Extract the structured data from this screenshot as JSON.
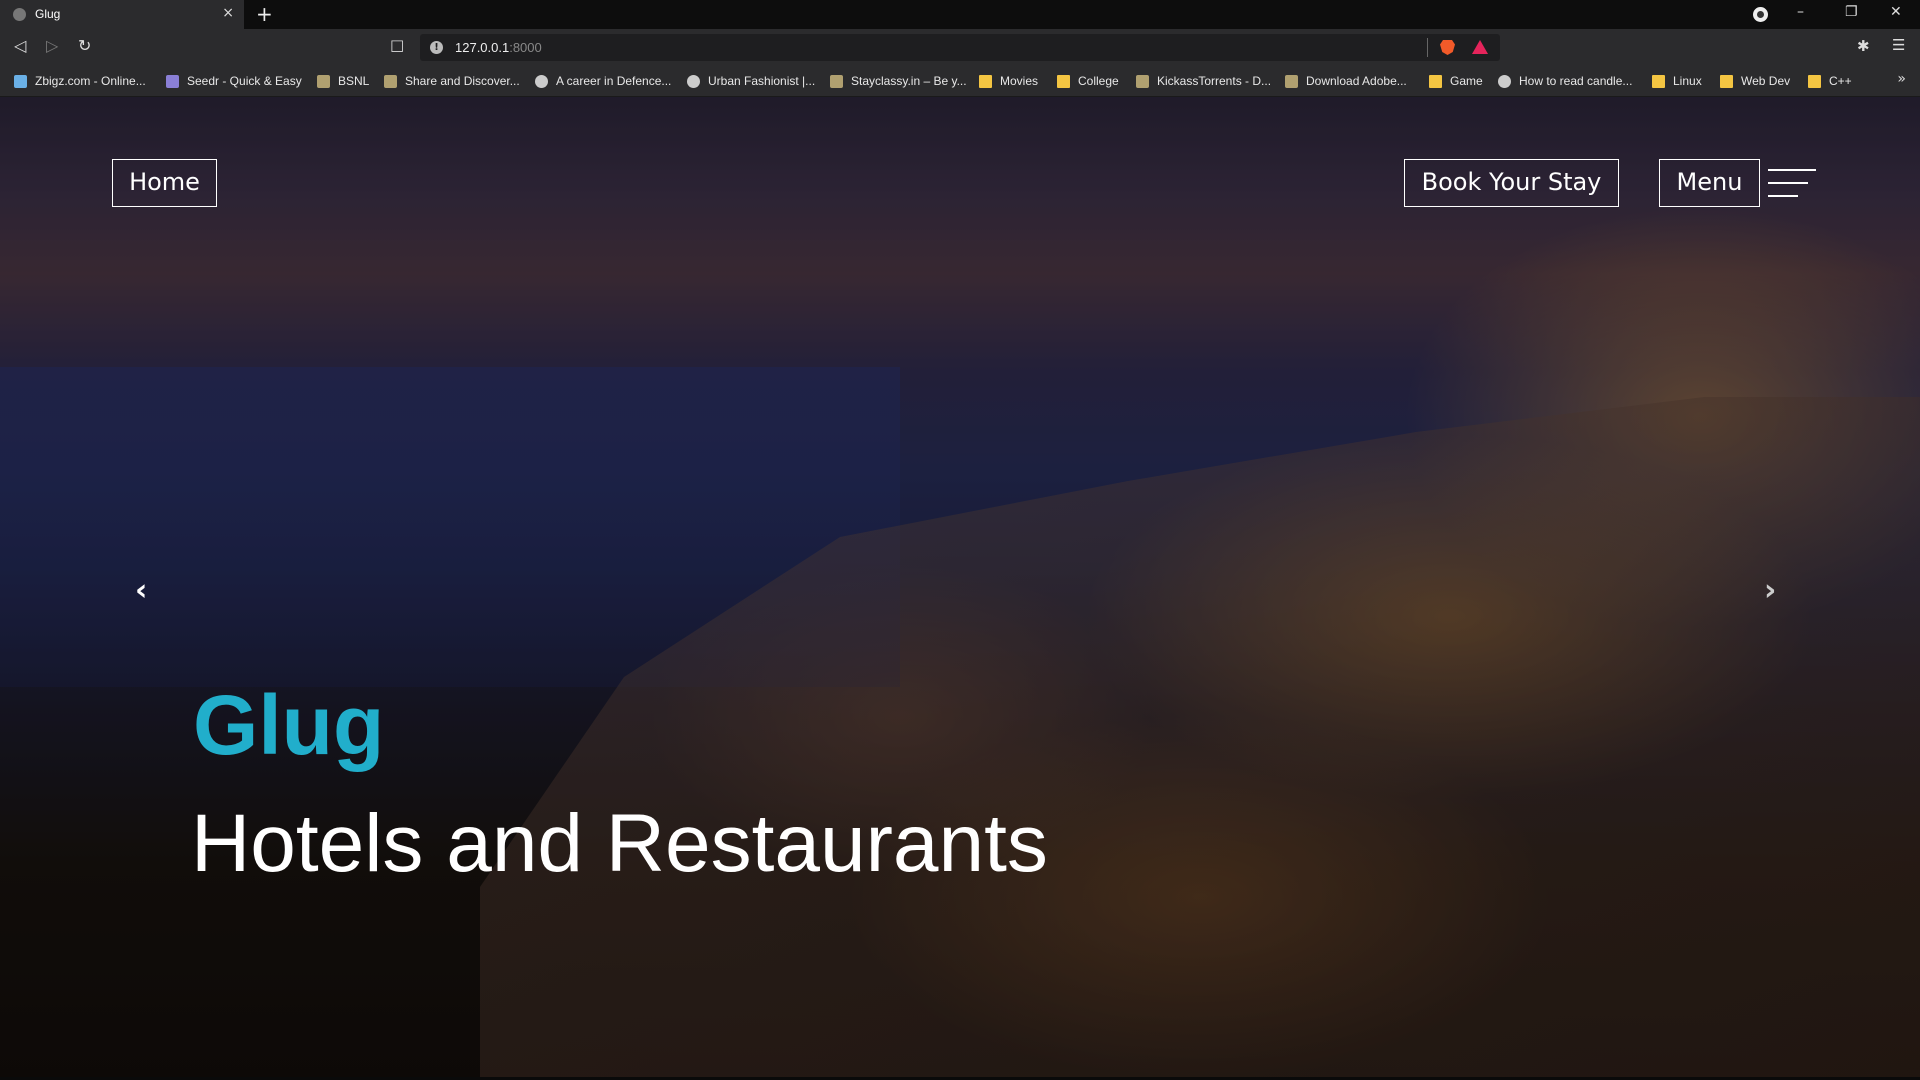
{
  "browser": {
    "tab_title": "Glug",
    "tab_close": "×",
    "new_tab": "+",
    "url_host": "127.0.0.1",
    "url_port": ":8000",
    "bookmarks": [
      {
        "label": "Zbigz.com - Online...",
        "icon": "cloud"
      },
      {
        "label": "Seedr - Quick & Easy",
        "icon": "seedr"
      },
      {
        "label": "BSNL",
        "icon": "site"
      },
      {
        "label": "Share and Discover...",
        "icon": "site"
      },
      {
        "label": "A career in Defence...",
        "icon": "globe"
      },
      {
        "label": "Urban Fashionist |...",
        "icon": "globe"
      },
      {
        "label": "Stayclassy.in – Be y...",
        "icon": "site"
      },
      {
        "label": "Movies",
        "icon": "folder"
      },
      {
        "label": "College",
        "icon": "folder"
      },
      {
        "label": "KickassTorrents - D...",
        "icon": "site"
      },
      {
        "label": "Download Adobe...",
        "icon": "site"
      },
      {
        "label": "Game",
        "icon": "folder"
      },
      {
        "label": "How to read candle...",
        "icon": "globe"
      },
      {
        "label": "Linux",
        "icon": "folder"
      },
      {
        "label": "Web Dev",
        "icon": "folder"
      },
      {
        "label": "C++",
        "icon": "folder"
      }
    ],
    "bookmarks_more": "»"
  },
  "page": {
    "home_label": "Home",
    "book_label": "Book Your Stay",
    "menu_label": "Menu",
    "prev_arrow": "‹",
    "next_arrow": "›",
    "brand": "Glug",
    "tagline": "Hotels and Restaurants"
  },
  "colors": {
    "brand": "#21aecb",
    "chrome_bg": "#2b2b2d",
    "tabbar_bg": "#0d0d0d"
  }
}
